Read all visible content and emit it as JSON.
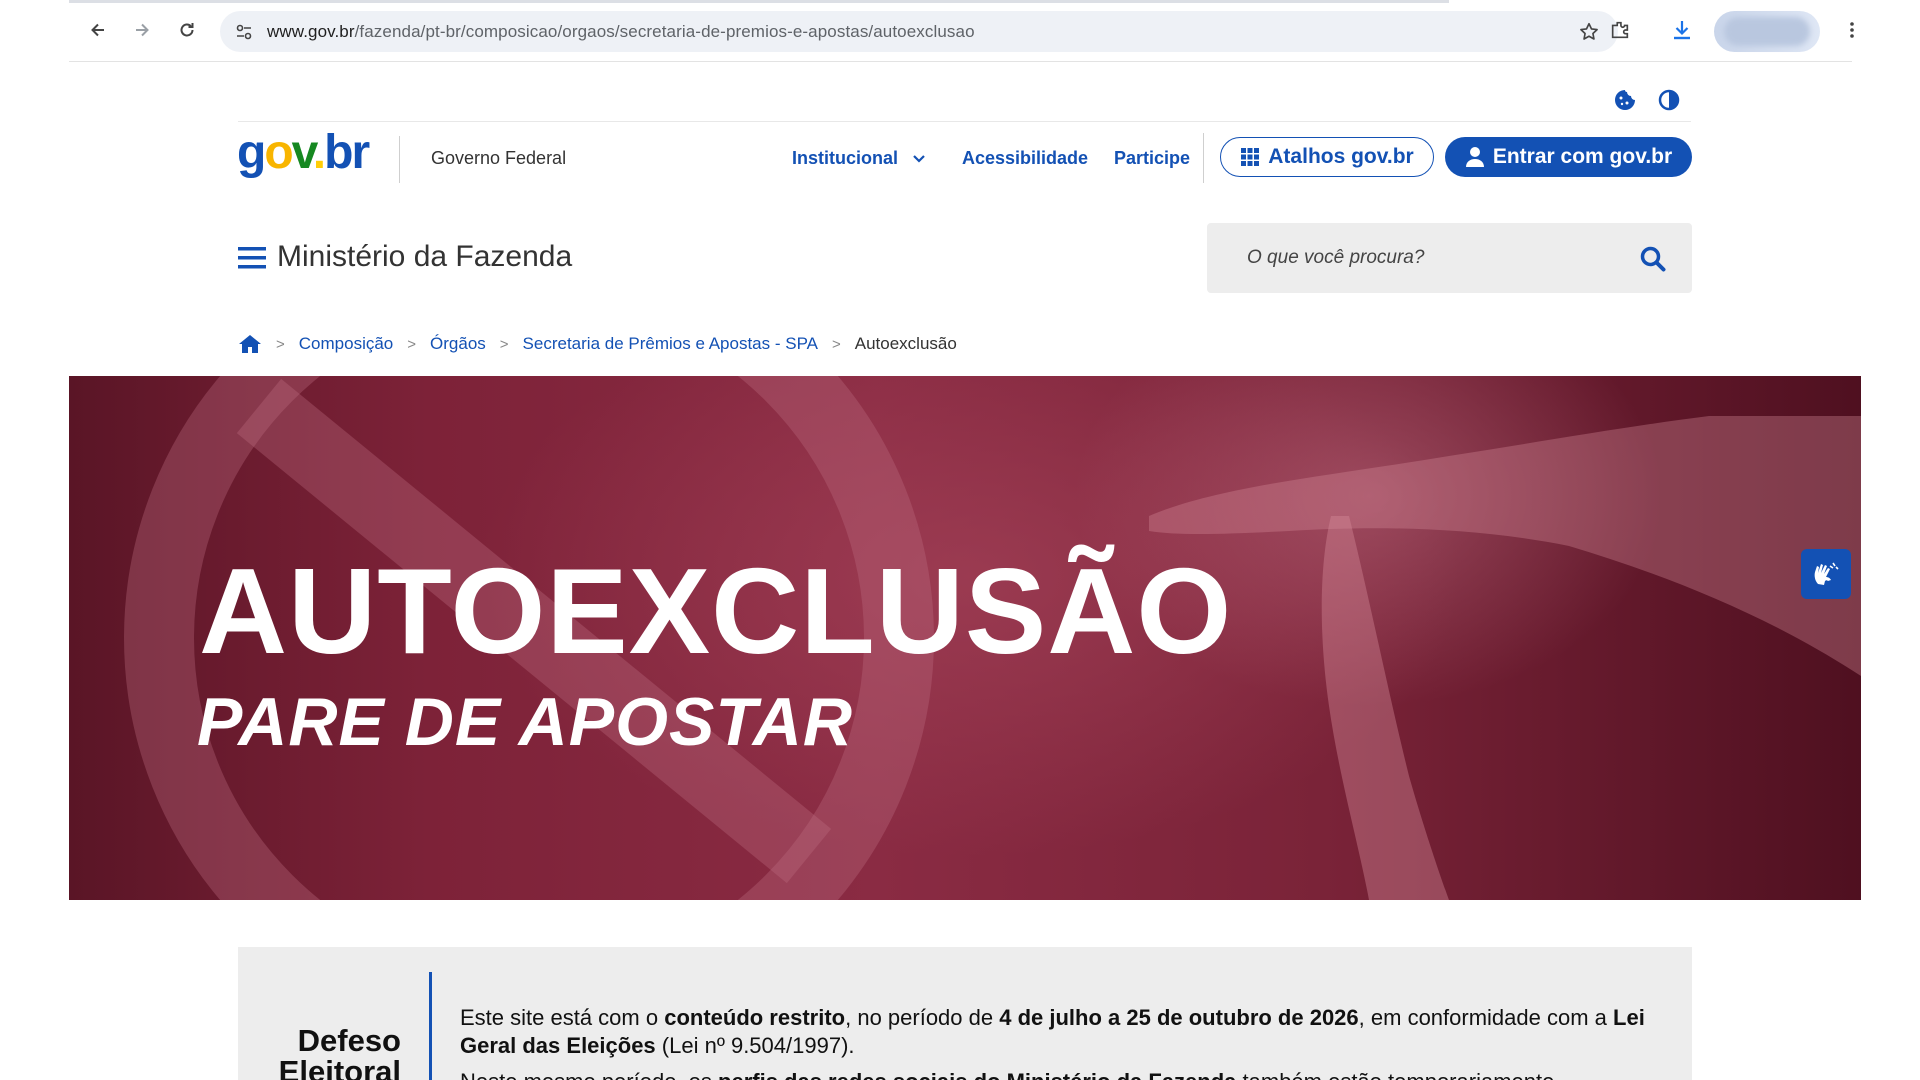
{
  "browser": {
    "url_host": "www.gov.br",
    "url_path": "/fazenda/pt-br/composicao/orgaos/secretaria-de-premios-e-apostas/autoexclusao"
  },
  "header": {
    "logo_text": "gov.br",
    "gov_federal": "Governo Federal",
    "links": {
      "institucional": "Institucional",
      "acessibilidade": "Acessibilidade",
      "participe": "Participe"
    },
    "atalhos_label": "Atalhos gov.br",
    "entrar_label": "Entrar com gov.br",
    "ministry_title": "Ministério da Fazenda",
    "search_placeholder": "O que você procura?"
  },
  "breadcrumb": {
    "items": [
      "Composição",
      "Órgãos",
      "Secretaria de Prêmios e Apostas - SPA"
    ],
    "current": "Autoexclusão"
  },
  "hero": {
    "title": "AUTOEXCLUSÃO",
    "subtitle": "PARE DE APOSTAR"
  },
  "notice": {
    "title_line1": "Defeso",
    "title_line2": "Eleitoral",
    "p1_a": "Este site está com o ",
    "p1_b": "conteúdo restrito",
    "p1_c": ", no período de ",
    "p1_d": "4 de julho a 25 de outubro de 2026",
    "p1_e": ", em conformidade com a ",
    "p1_f": "Lei Geral das Eleições",
    "p1_g": " (Lei nº 9.504/1997).",
    "p2_a": "Neste mesmo período, os ",
    "p2_b": "perfis das redes sociais do Ministério da Fazenda",
    "p2_c": " também estão temporariamente"
  },
  "colors": {
    "brand_blue": "#1351b4",
    "hero_maroon": "#7d2238"
  }
}
